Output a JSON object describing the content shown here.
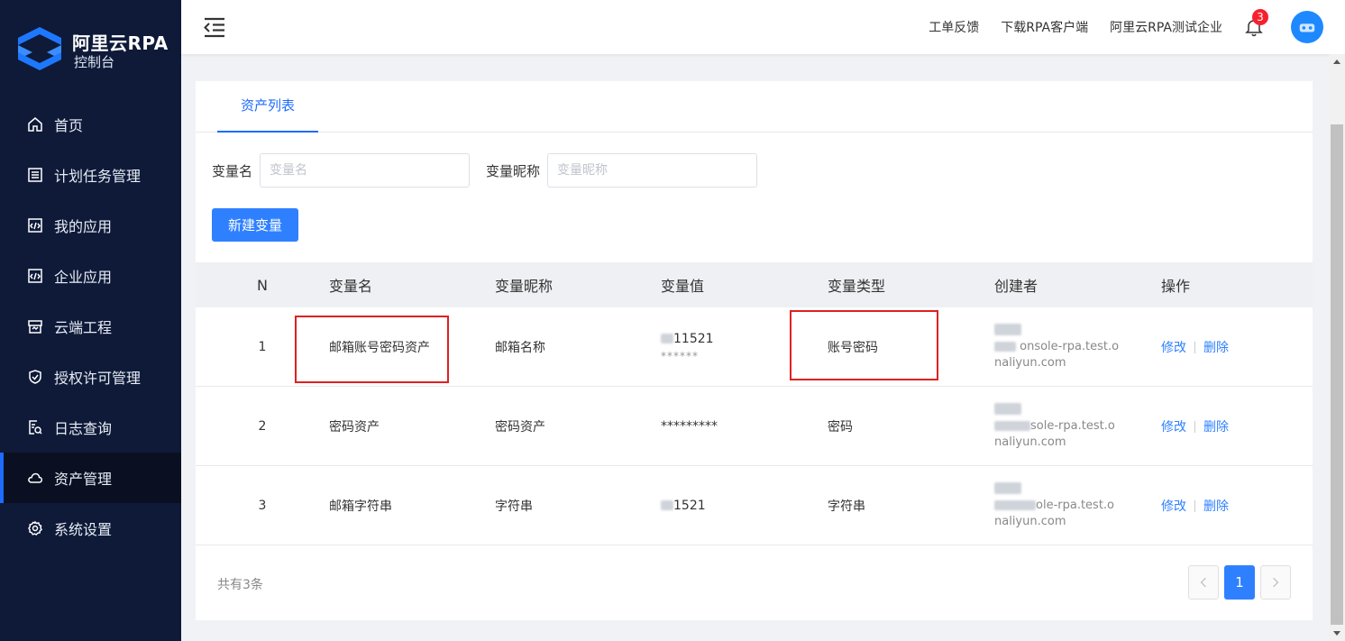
{
  "app": {
    "title": "阿里云RPA",
    "subtitle": "控制台"
  },
  "sidebar": {
    "items": [
      {
        "label": "首页",
        "icon": "home-icon"
      },
      {
        "label": "计划任务管理",
        "icon": "list-icon"
      },
      {
        "label": "我的应用",
        "icon": "code-icon"
      },
      {
        "label": "企业应用",
        "icon": "code-icon"
      },
      {
        "label": "云端工程",
        "icon": "cloud-project-icon"
      },
      {
        "label": "授权许可管理",
        "icon": "shield-icon"
      },
      {
        "label": "日志查询",
        "icon": "log-search-icon"
      },
      {
        "label": "资产管理",
        "icon": "cloud-icon",
        "active": true
      },
      {
        "label": "系统设置",
        "icon": "gear-icon"
      }
    ]
  },
  "header": {
    "links": [
      "工单反馈",
      "下载RPA客户端",
      "阿里云RPA测试企业"
    ],
    "notification_count": "3"
  },
  "tabs": [
    {
      "label": "资产列表",
      "active": true
    }
  ],
  "filters": {
    "var_name_label": "变量名",
    "var_name_placeholder": "变量名",
    "var_nick_label": "变量昵称",
    "var_nick_placeholder": "变量昵称"
  },
  "actions": {
    "new_label": "新建变量"
  },
  "table": {
    "columns": [
      "N",
      "变量名",
      "变量昵称",
      "变量值",
      "变量类型",
      "创建者",
      "操作"
    ],
    "rows": [
      {
        "n": "1",
        "name": "邮箱账号密码资产",
        "nick": "邮箱名称",
        "value": "11521",
        "value_sub": "******",
        "type": "账号密码",
        "creator_mail": "onsole-rpa.test.o",
        "creator_mail2": "naliyun.com",
        "edit": "修改",
        "delete": "删除"
      },
      {
        "n": "2",
        "name": "密码资产",
        "nick": "密码资产",
        "value": "*********",
        "value_sub": "",
        "type": "密码",
        "creator_mail": "sole-rpa.test.o",
        "creator_mail2": "naliyun.com",
        "edit": "修改",
        "delete": "删除"
      },
      {
        "n": "3",
        "name": "邮箱字符串",
        "nick": "字符串",
        "value": "1521",
        "value_sub": "",
        "type": "字符串",
        "creator_mail": "ole-rpa.test.o",
        "creator_mail2": "naliyun.com",
        "edit": "修改",
        "delete": "删除"
      }
    ]
  },
  "footer": {
    "total": "共有3条",
    "current_page": "1"
  },
  "colors": {
    "sidebar_bg": "#0e1a38",
    "accent": "#2f80ff",
    "highlight": "#e02020"
  }
}
